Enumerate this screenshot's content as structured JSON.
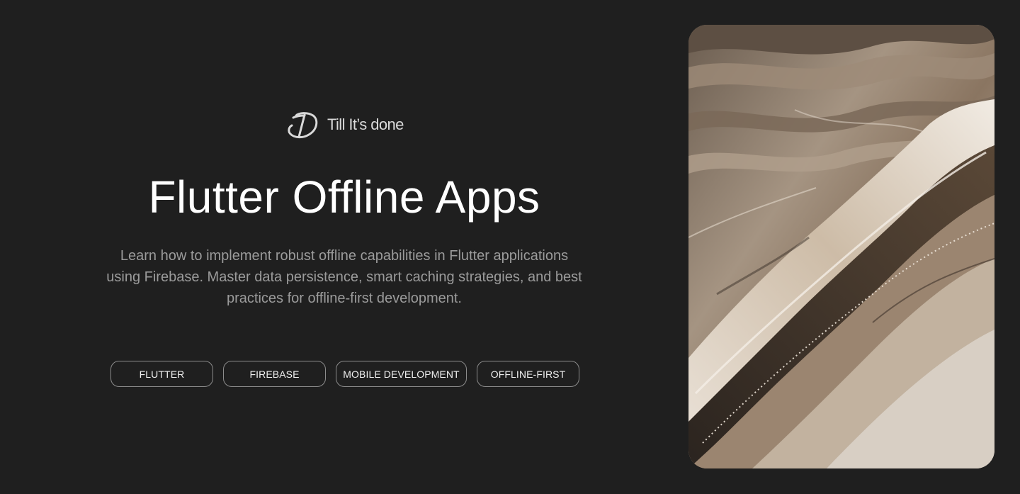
{
  "brand": {
    "name": "Till It’s done",
    "logo_icon": "td-monogram-logo"
  },
  "hero": {
    "title": "Flutter Offline Apps",
    "description": "Learn how to implement robust offline capabilities in Flutter applications using Firebase. Master data persistence, smart caching strategies, and best practices for offline-first development."
  },
  "tags": [
    {
      "label": "FLUTTER"
    },
    {
      "label": "FIREBASE"
    },
    {
      "label": "MOBILE DEVELOPMENT"
    },
    {
      "label": "OFFLINE-FIRST"
    }
  ],
  "image": {
    "subject": "abstract layered sand/stone texture",
    "palette": [
      "#4a3f36",
      "#8d7b69",
      "#c9b8a4",
      "#e7ded2",
      "#2e2823"
    ]
  },
  "colors": {
    "background": "#1f1f1f",
    "title": "#ffffff",
    "description": "#9b9b9b",
    "tag_border": "#8c8c8c",
    "tag_text": "#f0f0f0"
  }
}
